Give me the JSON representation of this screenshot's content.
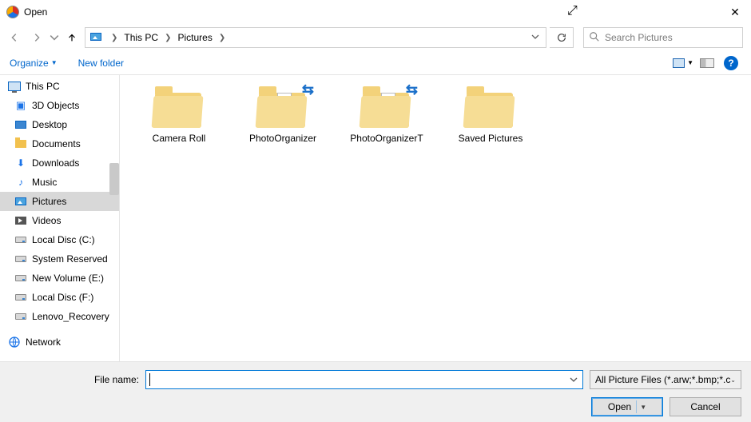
{
  "title": "Open",
  "breadcrumb": {
    "items": [
      "This PC",
      "Pictures"
    ]
  },
  "search": {
    "placeholder": "Search Pictures"
  },
  "toolbar": {
    "organize": "Organize",
    "newfolder": "New folder"
  },
  "tree": {
    "items": [
      {
        "label": "This PC",
        "icon": "monitor",
        "level": 0
      },
      {
        "label": "3D Objects",
        "icon": "cube"
      },
      {
        "label": "Desktop",
        "icon": "desktop"
      },
      {
        "label": "Documents",
        "icon": "folder"
      },
      {
        "label": "Downloads",
        "icon": "down"
      },
      {
        "label": "Music",
        "icon": "music"
      },
      {
        "label": "Pictures",
        "icon": "pic",
        "selected": true
      },
      {
        "label": "Videos",
        "icon": "video"
      },
      {
        "label": "Local Disc (C:)",
        "icon": "drive"
      },
      {
        "label": "System Reserved",
        "icon": "drive"
      },
      {
        "label": "New Volume (E:)",
        "icon": "drive"
      },
      {
        "label": "Local Disc (F:)",
        "icon": "drive"
      },
      {
        "label": "Lenovo_Recovery",
        "icon": "drive"
      },
      {
        "label": "",
        "icon": "",
        "spacer": true
      },
      {
        "label": "Network",
        "icon": "net",
        "level": 0
      }
    ]
  },
  "folders": [
    {
      "name": "Camera Roll",
      "variant": "plain"
    },
    {
      "name": "PhotoOrganizer",
      "variant": "sync"
    },
    {
      "name": "PhotoOrganizerT",
      "variant": "sync"
    },
    {
      "name": "Saved Pictures",
      "variant": "plain"
    }
  ],
  "bottom": {
    "filename_label": "File name:",
    "filename_value": "",
    "filter_label": "All Picture Files (*.arw;*.bmp;*.c",
    "open": "Open",
    "cancel": "Cancel"
  }
}
